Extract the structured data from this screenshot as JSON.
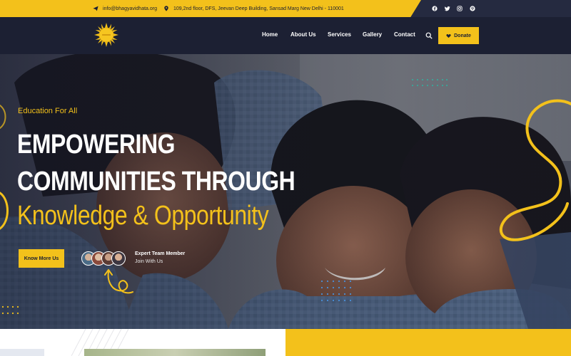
{
  "topbar": {
    "email": "info@bhagyavidhata.org",
    "address": "109,2nd floor, DFS, Jeevan Deep Building, Sansad Marg New Delhi - 110001",
    "email_icon": "paper-plane-icon",
    "address_icon": "map-pin-icon",
    "socials": [
      "facebook-icon",
      "twitter-icon",
      "instagram-icon",
      "pinterest-icon"
    ]
  },
  "nav": {
    "logo_icon": "sun-logo-icon",
    "links": [
      "Home",
      "About Us",
      "Services",
      "Gallery",
      "Contact"
    ],
    "search_icon": "search-icon",
    "donate_label": "Donate"
  },
  "hero": {
    "kicker": "Education For All",
    "headline_line1": "EMPOWERING",
    "headline_line2": "COMMUNITIES THROUGH",
    "headline_line3": "Knowledge & Opportunity",
    "cta_label": "Know More Us",
    "team_title": "Expert Team Member",
    "team_subtitle": "Join With Us"
  },
  "colors": {
    "accent": "#f3c11b",
    "navy": "#1c2033",
    "topbar_dark": "#252a40",
    "white": "#ffffff"
  }
}
